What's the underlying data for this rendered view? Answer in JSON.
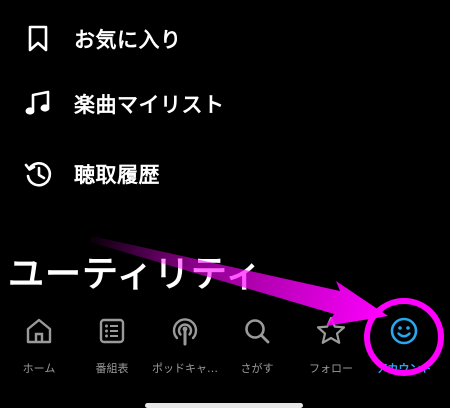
{
  "menu": {
    "items": [
      {
        "label": "お気に入り",
        "icon": "bookmark-icon"
      },
      {
        "label": "楽曲マイリスト",
        "icon": "music-note-icon"
      },
      {
        "label": "聴取履歴",
        "icon": "history-icon"
      }
    ]
  },
  "section": {
    "title": "ユーティリティ"
  },
  "tabbar": {
    "active_color": "#2aa6f0",
    "inactive_color": "#9a9a9a",
    "tabs": [
      {
        "label": "ホーム",
        "icon": "home-icon"
      },
      {
        "label": "番組表",
        "icon": "program-guide-icon"
      },
      {
        "label": "ポッドキャ…",
        "icon": "podcast-icon"
      },
      {
        "label": "さがす",
        "icon": "search-icon"
      },
      {
        "label": "フォロー",
        "icon": "star-icon"
      },
      {
        "label": "アカウント",
        "icon": "smiley-icon",
        "active": true
      }
    ]
  },
  "annotation": {
    "color": "#ff00ff"
  }
}
